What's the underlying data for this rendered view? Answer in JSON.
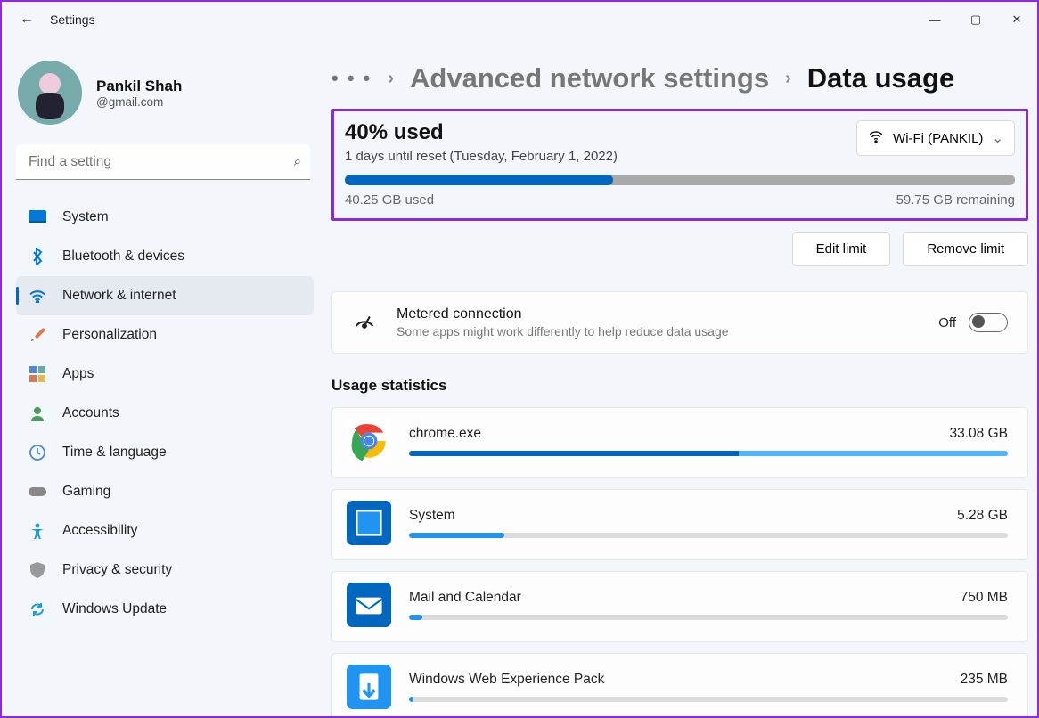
{
  "window": {
    "title": "Settings"
  },
  "profile": {
    "name": "Pankil Shah",
    "email": "@gmail.com"
  },
  "search": {
    "placeholder": "Find a setting"
  },
  "nav": {
    "items": [
      {
        "label": "System",
        "name": "system",
        "iconColor": "#0078d4"
      },
      {
        "label": "Bluetooth & devices",
        "name": "bluetooth",
        "iconColor": "#0078d4"
      },
      {
        "label": "Network & internet",
        "name": "network",
        "iconColor": "#0078d4",
        "active": true
      },
      {
        "label": "Personalization",
        "name": "personalization",
        "iconColor": "#d87a50"
      },
      {
        "label": "Apps",
        "name": "apps",
        "iconColor": "#4a88da"
      },
      {
        "label": "Accounts",
        "name": "accounts",
        "iconColor": "#4a9c5e"
      },
      {
        "label": "Time & language",
        "name": "time-language",
        "iconColor": "#4a88da"
      },
      {
        "label": "Gaming",
        "name": "gaming",
        "iconColor": "#888"
      },
      {
        "label": "Accessibility",
        "name": "accessibility",
        "iconColor": "#1a9fde"
      },
      {
        "label": "Privacy & security",
        "name": "privacy",
        "iconColor": "#999"
      },
      {
        "label": "Windows Update",
        "name": "windows-update",
        "iconColor": "#1a9fde"
      }
    ]
  },
  "breadcrumb": {
    "overflow": "…",
    "parent": "Advanced network settings",
    "current": "Data usage"
  },
  "usage": {
    "percent_label": "40% used",
    "reset_label": "1 days until reset (Tuesday, February 1, 2022)",
    "used_label": "40.25 GB used",
    "remaining_label": "59.75 GB remaining",
    "percent": 40,
    "network_selector": "Wi-Fi (PANKIL)"
  },
  "buttons": {
    "edit": "Edit limit",
    "remove": "Remove limit"
  },
  "metered": {
    "title": "Metered connection",
    "desc": "Some apps might work differently to help reduce data usage",
    "state_label": "Off"
  },
  "stats": {
    "heading": "Usage statistics",
    "max_bytes": 33080000000,
    "apps": [
      {
        "name": "chrome.exe",
        "usage_label": "33.08 GB",
        "bytes": 33080000000,
        "icon": "chrome",
        "seg1": 0.55,
        "seg2": 0.45
      },
      {
        "name": "System",
        "usage_label": "5.28 GB",
        "bytes": 5280000000,
        "icon": "system",
        "color": "#0067c0"
      },
      {
        "name": "Mail and Calendar",
        "usage_label": "750 MB",
        "bytes": 750000000,
        "icon": "mail",
        "color": "#0067c0"
      },
      {
        "name": "Windows Web Experience Pack",
        "usage_label": "235 MB",
        "bytes": 235000000,
        "icon": "web",
        "color": "#2094f3"
      }
    ]
  }
}
